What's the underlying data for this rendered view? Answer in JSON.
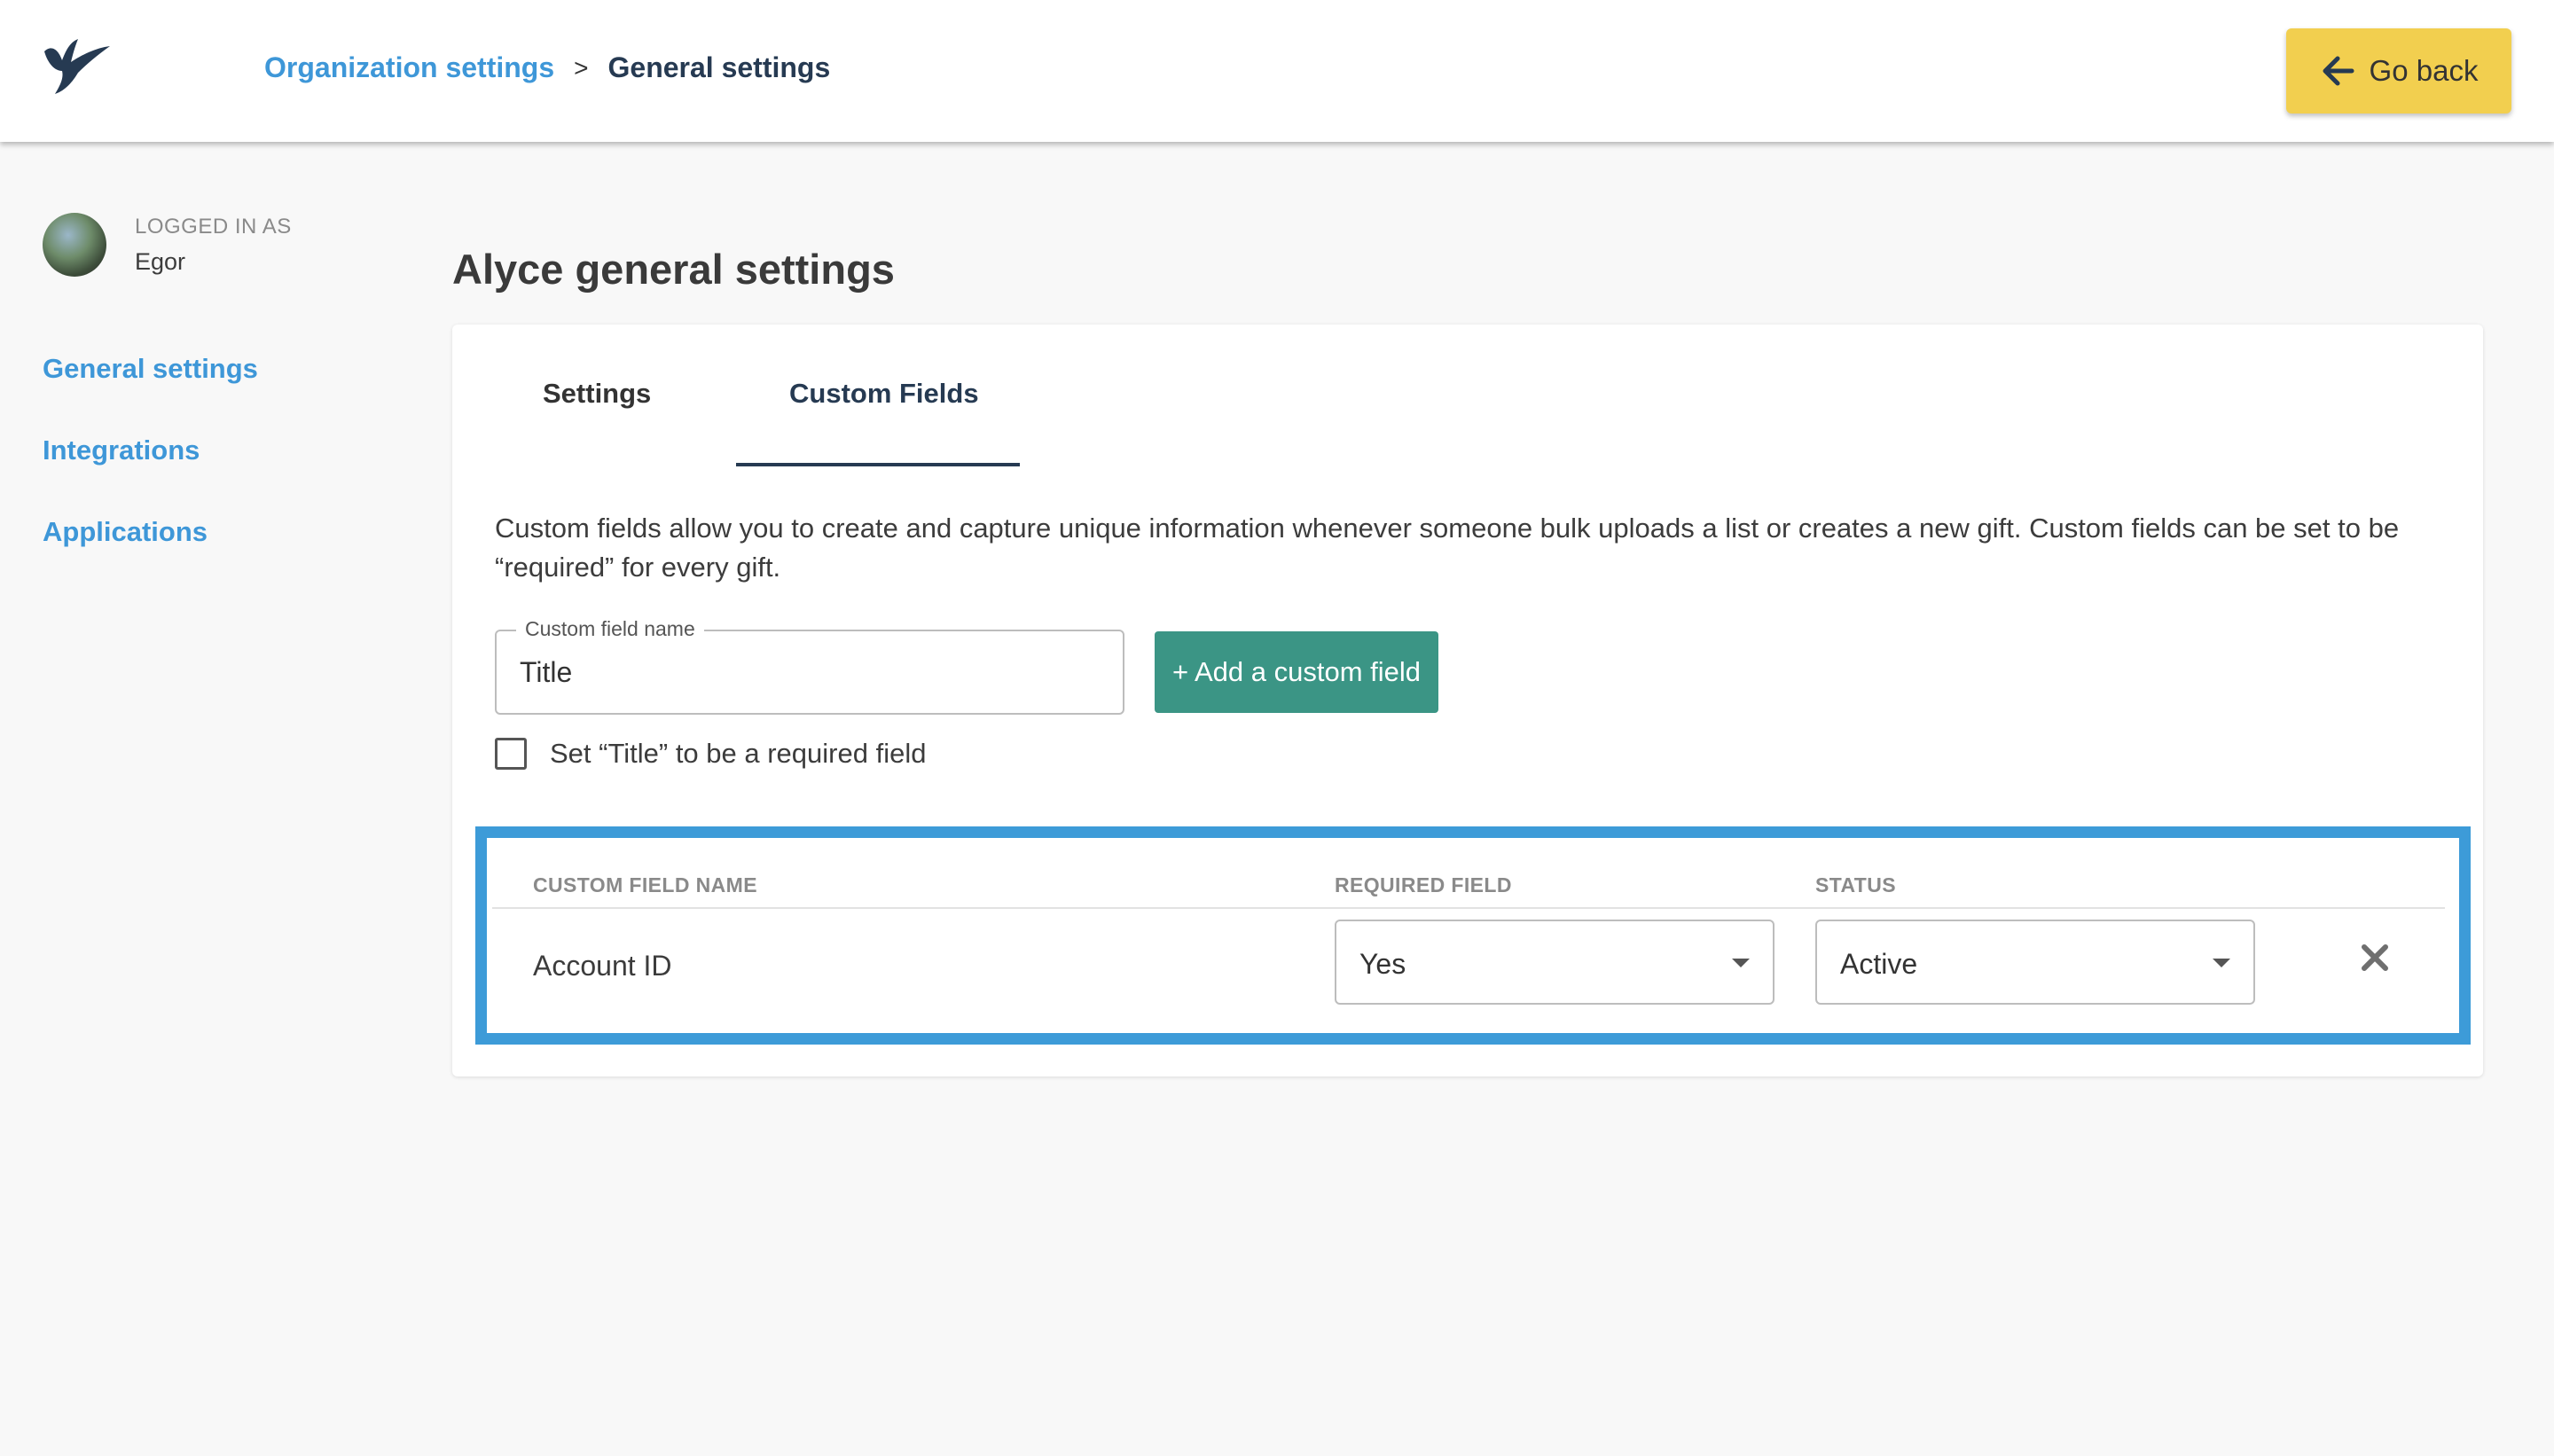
{
  "breadcrumb": {
    "parent": "Organization settings",
    "separator": ">",
    "current": "General settings"
  },
  "header": {
    "go_back_label": "Go back"
  },
  "user": {
    "logged_in_label": "LOGGED IN AS",
    "name": "Egor"
  },
  "sidebar": {
    "items": [
      {
        "label": "General settings"
      },
      {
        "label": "Integrations"
      },
      {
        "label": "Applications"
      }
    ]
  },
  "page": {
    "title": "Alyce general settings"
  },
  "tabs": [
    {
      "label": "Settings"
    },
    {
      "label": "Custom Fields"
    }
  ],
  "custom_fields": {
    "description": "Custom fields allow you to create and capture unique information whenever someone bulk uploads a list or creates a new gift. Custom fields can be set to be “required” for every gift.",
    "field_label": "Custom field name",
    "field_value": "Title",
    "add_button_label": "+ Add a custom field",
    "required_checkbox_label": "Set “Title” to be a required field",
    "table": {
      "headers": {
        "name": "CUSTOM FIELD NAME",
        "required": "REQUIRED FIELD",
        "status": "STATUS"
      },
      "rows": [
        {
          "name": "Account ID",
          "required": "Yes",
          "status": "Active"
        }
      ]
    }
  },
  "colors": {
    "link": "#3e97d8",
    "primary_dark": "#263a52",
    "go_back_bg": "#f2cf4f",
    "add_button_bg": "#3b9585",
    "highlight_frame": "#3d9bd8"
  }
}
